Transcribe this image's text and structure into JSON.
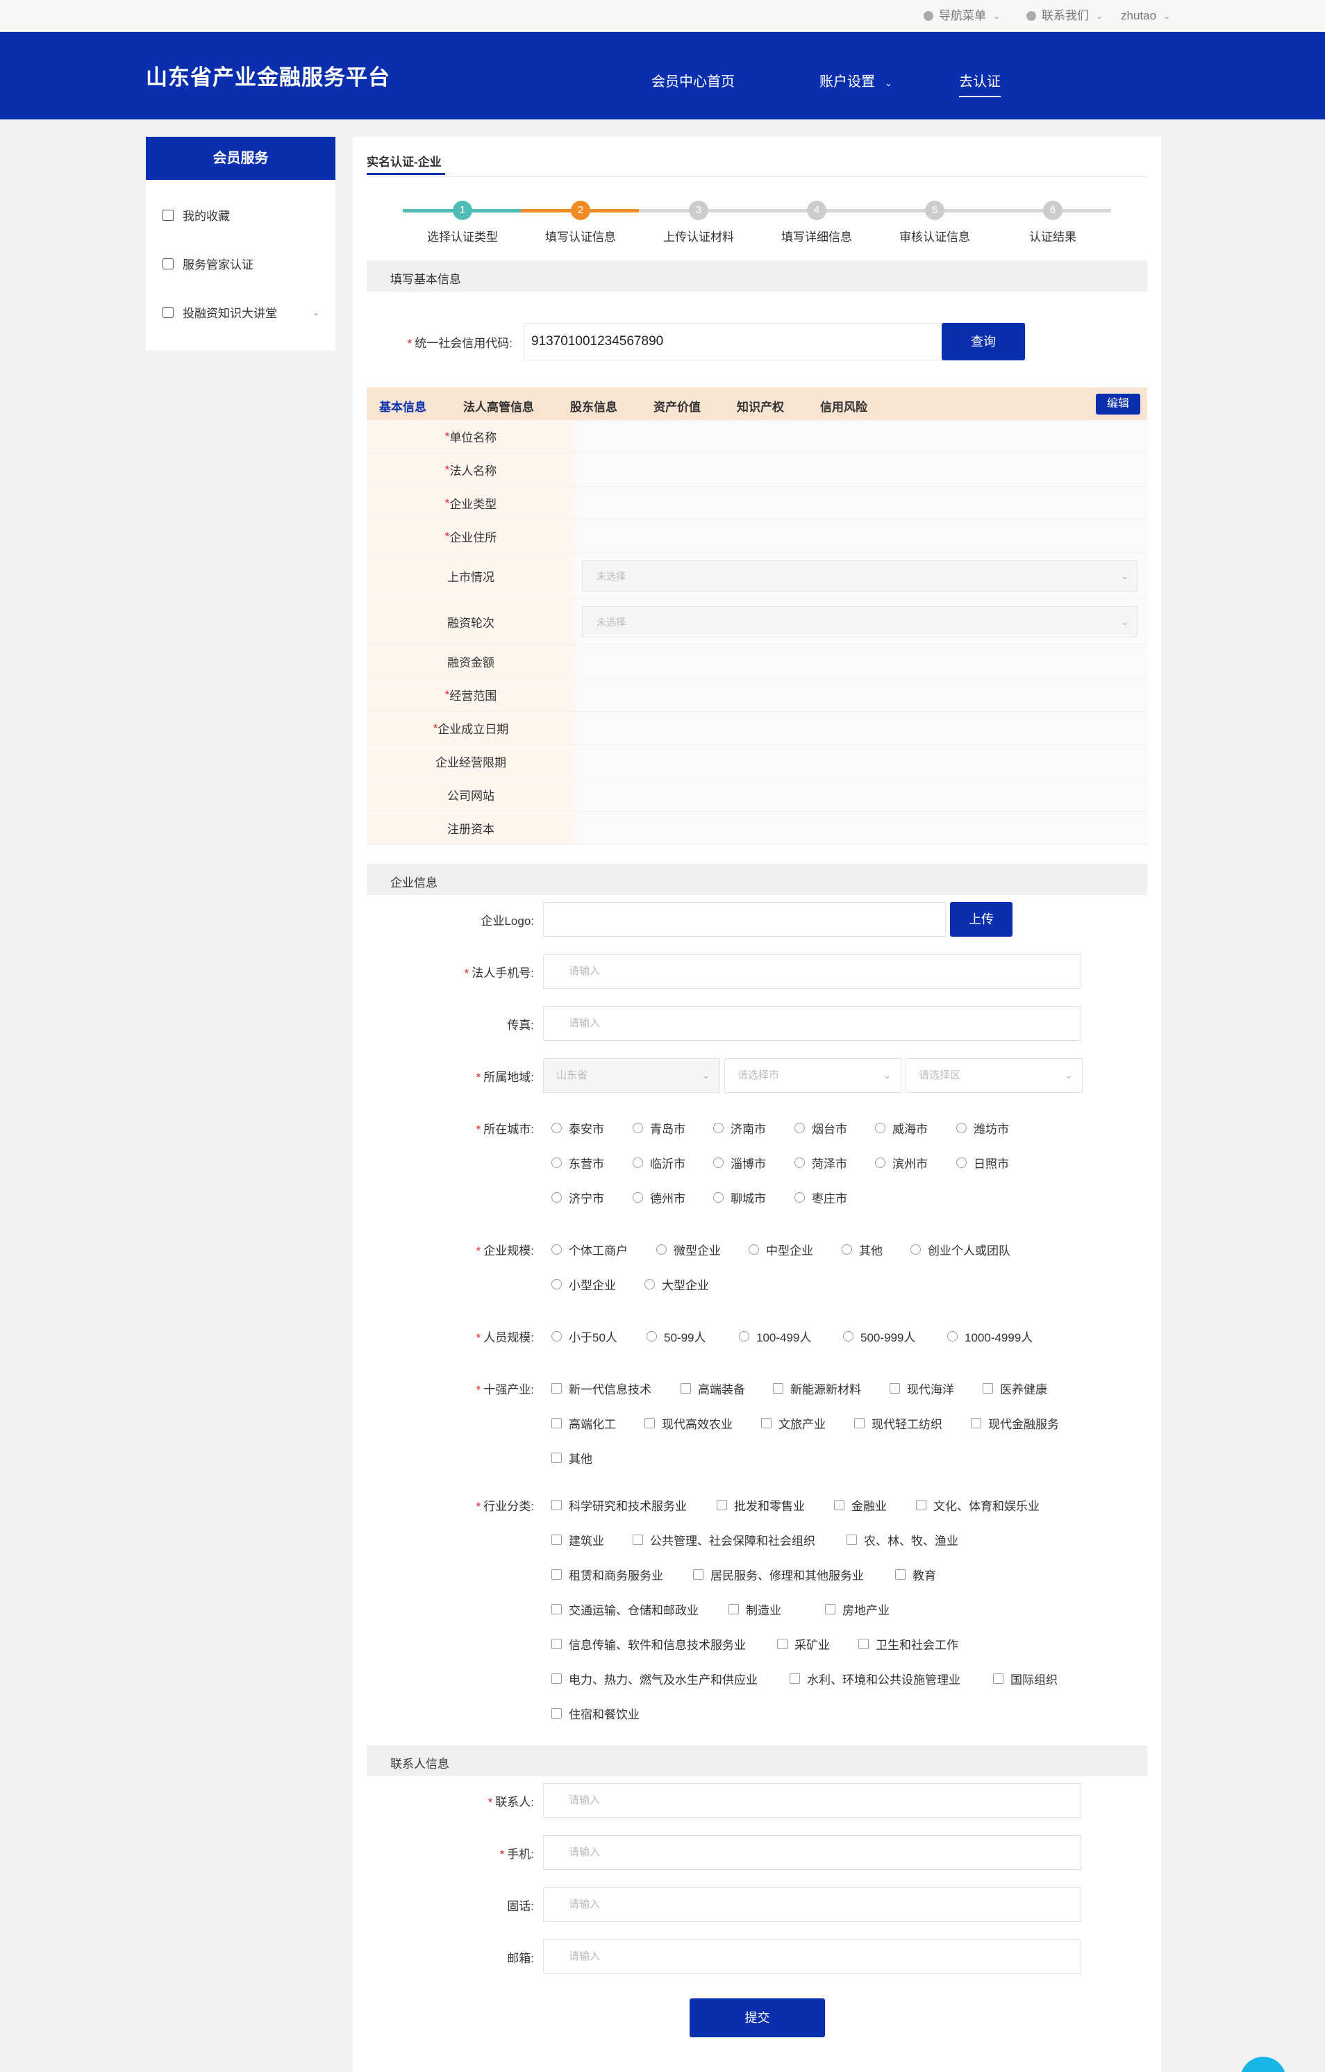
{
  "topbar": {
    "nav_menu": "导航菜单",
    "contact": "联系我们",
    "user": "zhutao"
  },
  "header": {
    "brand": "山东省产业金融服务平台",
    "nav": [
      "会员中心首页",
      "账户设置",
      "去认证"
    ]
  },
  "sidebar": {
    "title": "会员服务",
    "items": [
      "我的收藏",
      "服务管家认证",
      "投融资知识大讲堂"
    ]
  },
  "page": {
    "tab": "实名认证-企业"
  },
  "steps": [
    {
      "num": "1",
      "label": "选择认证类型"
    },
    {
      "num": "2",
      "label": "填写认证信息"
    },
    {
      "num": "3",
      "label": "上传认证材料"
    },
    {
      "num": "4",
      "label": "填写详细信息"
    },
    {
      "num": "5",
      "label": "审核认证信息"
    },
    {
      "num": "6",
      "label": "认证结果"
    }
  ],
  "basic": {
    "section": "填写基本信息",
    "code_label": "统一社会信用代码:",
    "code_value": "913701001234567890",
    "query_btn": "查询"
  },
  "info_tabs": [
    "基本信息",
    "法人高管信息",
    "股东信息",
    "资产价值",
    "知识产权",
    "信用风险"
  ],
  "edit_btn": "编辑",
  "info_rows": [
    {
      "label": "单位名称",
      "req": true
    },
    {
      "label": "法人名称",
      "req": true
    },
    {
      "label": "企业类型",
      "req": true
    },
    {
      "label": "企业住所",
      "req": true
    },
    {
      "label": "上市情况",
      "req": false,
      "select": "未选择"
    },
    {
      "label": "融资轮次",
      "req": false,
      "select": "未选择"
    },
    {
      "label": "融资金额",
      "req": false
    },
    {
      "label": "经营范围",
      "req": true
    },
    {
      "label": "企业成立日期",
      "req": true
    },
    {
      "label": "企业经营限期",
      "req": false
    },
    {
      "label": "公司网站",
      "req": false
    },
    {
      "label": "注册资本",
      "req": false
    }
  ],
  "company": {
    "section": "企业信息",
    "logo_label": "企业Logo:",
    "upload_btn": "上传",
    "phone_label": "法人手机号:",
    "fax_label": "传真:",
    "region_label": "所属地域:",
    "province": "山东省",
    "city_ph": "请选择市",
    "district_ph": "请选择区",
    "placeholder": "请输入",
    "city_label": "所在城市:",
    "cities": [
      "泰安市",
      "青岛市",
      "济南市",
      "烟台市",
      "威海市",
      "潍坊市",
      "东营市",
      "临沂市",
      "淄博市",
      "菏泽市",
      "滨州市",
      "日照市",
      "济宁市",
      "德州市",
      "聊城市",
      "枣庄市"
    ],
    "scale_label": "企业规模:",
    "scales": [
      "个体工商户",
      "微型企业",
      "中型企业",
      "其他",
      "创业个人或团队",
      "小型企业",
      "大型企业"
    ],
    "staff_label": "人员规模:",
    "staff": [
      "小于50人",
      "50-99人",
      "100-499人",
      "500-999人",
      "1000-4999人"
    ],
    "industry10_label": "十强产业:",
    "industry10": [
      "新一代信息技术",
      "高端装备",
      "新能源新材料",
      "现代海洋",
      "医养健康",
      "高端化工",
      "现代高效农业",
      "文旅产业",
      "现代轻工纺织",
      "现代金融服务",
      "其他"
    ],
    "category_label": "行业分类:",
    "categories": [
      "科学研究和技术服务业",
      "批发和零售业",
      "金融业",
      "文化、体育和娱乐业",
      "建筑业",
      "公共管理、社会保障和社会组织",
      "农、林、牧、渔业",
      "租赁和商务服务业",
      "居民服务、修理和其他服务业",
      "教育",
      "交通运输、仓储和邮政业",
      "制造业",
      "房地产业",
      "信息传输、软件和信息技术服务业",
      "采矿业",
      "卫生和社会工作",
      "电力、热力、燃气及水生产和供应业",
      "水利、环境和公共设施管理业",
      "国际组织",
      "住宿和餐饮业"
    ]
  },
  "contact": {
    "section": "联系人信息",
    "name_label": "联系人:",
    "mobile_label": "手机:",
    "tel_label": "固话:",
    "email_label": "邮箱:"
  },
  "submit_btn": "提交",
  "colors": {
    "brand": "#0a2fae",
    "step_done": "#4fbdb5",
    "step_active": "#f08a24",
    "step_todo": "#cccccc"
  }
}
